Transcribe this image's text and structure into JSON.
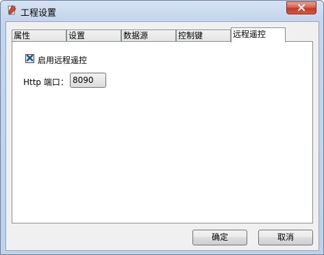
{
  "window": {
    "title": "工程设置",
    "app_icon": "project-settings-icon",
    "close_icon": "close-icon"
  },
  "tabs": [
    {
      "label": "属性",
      "active": false
    },
    {
      "label": "设置",
      "active": false
    },
    {
      "label": "数据源",
      "active": false
    },
    {
      "label": "控制键",
      "active": false
    },
    {
      "label": "远程遥控",
      "active": true
    }
  ],
  "remote_control": {
    "enable_label": "启用远程遥控",
    "enable_checked": true,
    "port_label": "Http 端口：",
    "port_value": "8090"
  },
  "buttons": {
    "ok_label": "确定",
    "cancel_label": "取消"
  },
  "colors": {
    "close_button": "#c23b22",
    "checkbox_mark": "#1c5180",
    "frame": "#bfd2ea"
  }
}
